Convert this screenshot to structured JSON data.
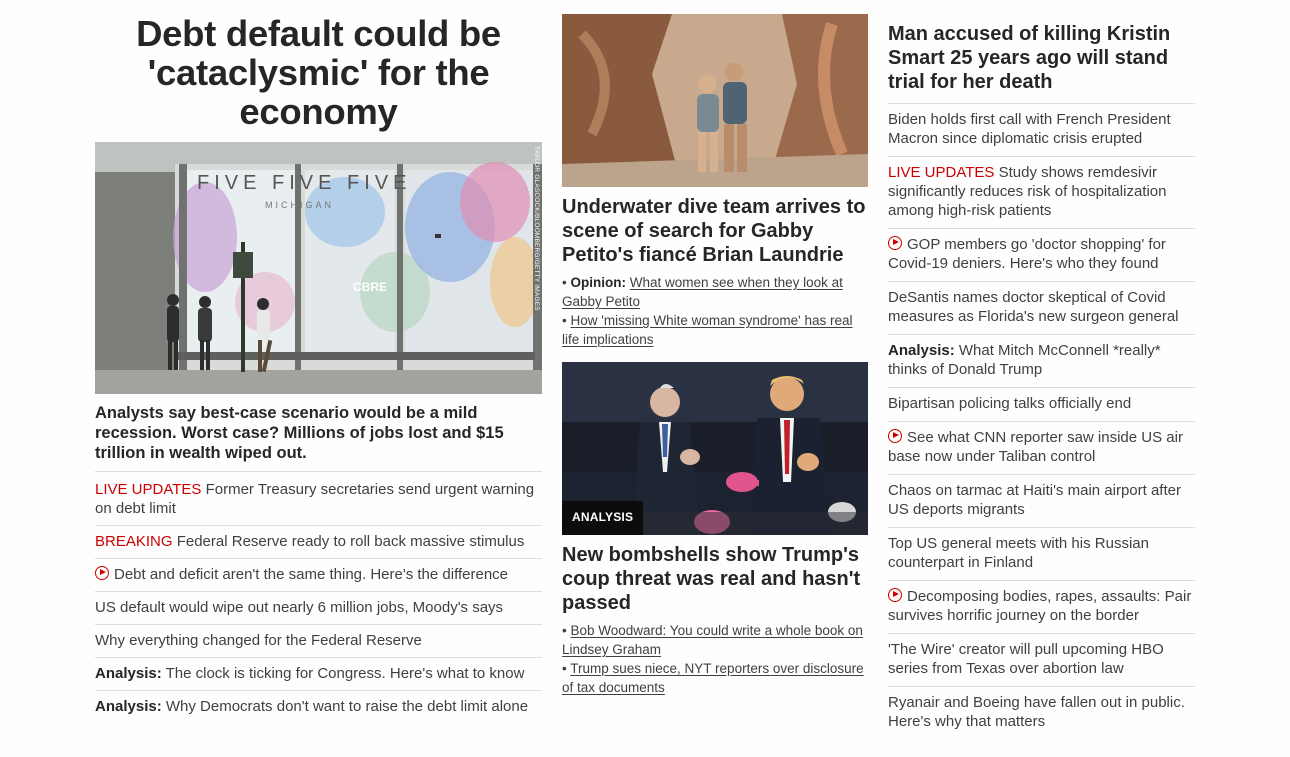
{
  "column1": {
    "headline": "Debt default could be 'cataclysmic' for the economy",
    "photo": {
      "credit": "TAYLOR GLASCOCK/BLOOMBERG/GETTY IMAGES",
      "sign_text": "FIVE FIVE FIVE",
      "sign_sub": "MICHIGAN",
      "cbre_text": "CBRE"
    },
    "lede": "Analysts say best-case scenario would be a mild recession. Worst case? Millions of jobs lost and $15 trillion in wealth wiped out.",
    "items": [
      {
        "tag": "LIVE UPDATES",
        "tag_style": "red",
        "text": "Former Treasury secretaries send urgent warning on debt limit"
      },
      {
        "tag": "BREAKING",
        "tag_style": "red",
        "text": "Federal Reserve ready to roll back massive stimulus"
      },
      {
        "video": true,
        "text": "Debt and deficit aren't the same thing. Here's the difference"
      },
      {
        "text": "US default would wipe out nearly 6 million jobs, Moody's says"
      },
      {
        "text": "Why everything changed for the Federal Reserve"
      },
      {
        "tag": "Analysis:",
        "tag_style": "bold",
        "text": "The clock is ticking for Congress. Here's what to know"
      },
      {
        "tag": "Analysis:",
        "tag_style": "bold",
        "text": "Why Democrats don't want to raise the debt limit alone"
      }
    ]
  },
  "column2": {
    "card1": {
      "title": "Underwater dive team arrives to scene of search for Gabby Petito's fiancé Brian Laundrie",
      "sublinks": [
        {
          "bullet": "•",
          "label": "Opinion:",
          "text": "What women see when they look at Gabby Petito"
        },
        {
          "bullet": "•",
          "label": "",
          "text": "How 'missing White woman syndrome' has real life implications"
        }
      ]
    },
    "card2": {
      "badge": "ANALYSIS",
      "title": "New bombshells show Trump's coup threat was real and hasn't passed",
      "sublinks": [
        {
          "bullet": "•",
          "label": "",
          "text": "Bob Woodward: You could write a whole book on Lindsey Graham"
        },
        {
          "bullet": "•",
          "label": "",
          "text": "Trump sues niece, NYT reporters over disclosure of tax documents"
        }
      ]
    }
  },
  "column3": {
    "headline": "Man accused of killing Kristin Smart 25 years ago will stand trial for her death",
    "items": [
      {
        "text": "Biden holds first call with French President Macron since diplomatic crisis erupted"
      },
      {
        "tag": "LIVE UPDATES",
        "tag_style": "red",
        "text": "Study shows remdesivir significantly reduces risk of hospitalization among high-risk patients"
      },
      {
        "video": true,
        "text": "GOP members go 'doctor shopping' for Covid-19 deniers. Here's who they found"
      },
      {
        "text": "DeSantis names doctor skeptical of Covid measures as Florida's new surgeon general"
      },
      {
        "tag": "Analysis:",
        "tag_style": "bold",
        "text": "What Mitch McConnell *really* thinks of Donald Trump"
      },
      {
        "text": "Bipartisan policing talks officially end"
      },
      {
        "video": true,
        "text": "See what CNN reporter saw inside US air base now under Taliban control"
      },
      {
        "text": "Chaos on tarmac at Haiti's main airport after US deports migrants"
      },
      {
        "text": "Top US general meets with his Russian counterpart in Finland"
      },
      {
        "video": true,
        "text": "Decomposing bodies, rapes, assaults: Pair survives horrific journey on the border"
      },
      {
        "text": "'The Wire' creator will pull upcoming HBO series from Texas over abortion law"
      },
      {
        "text": "Ryanair and Boeing have fallen out in public. Here's why that matters"
      }
    ]
  },
  "colors": {
    "accent_red": "#cc0000",
    "text": "#262626",
    "divider": "#dedede"
  },
  "icons": {
    "video": "play-circle-icon"
  }
}
